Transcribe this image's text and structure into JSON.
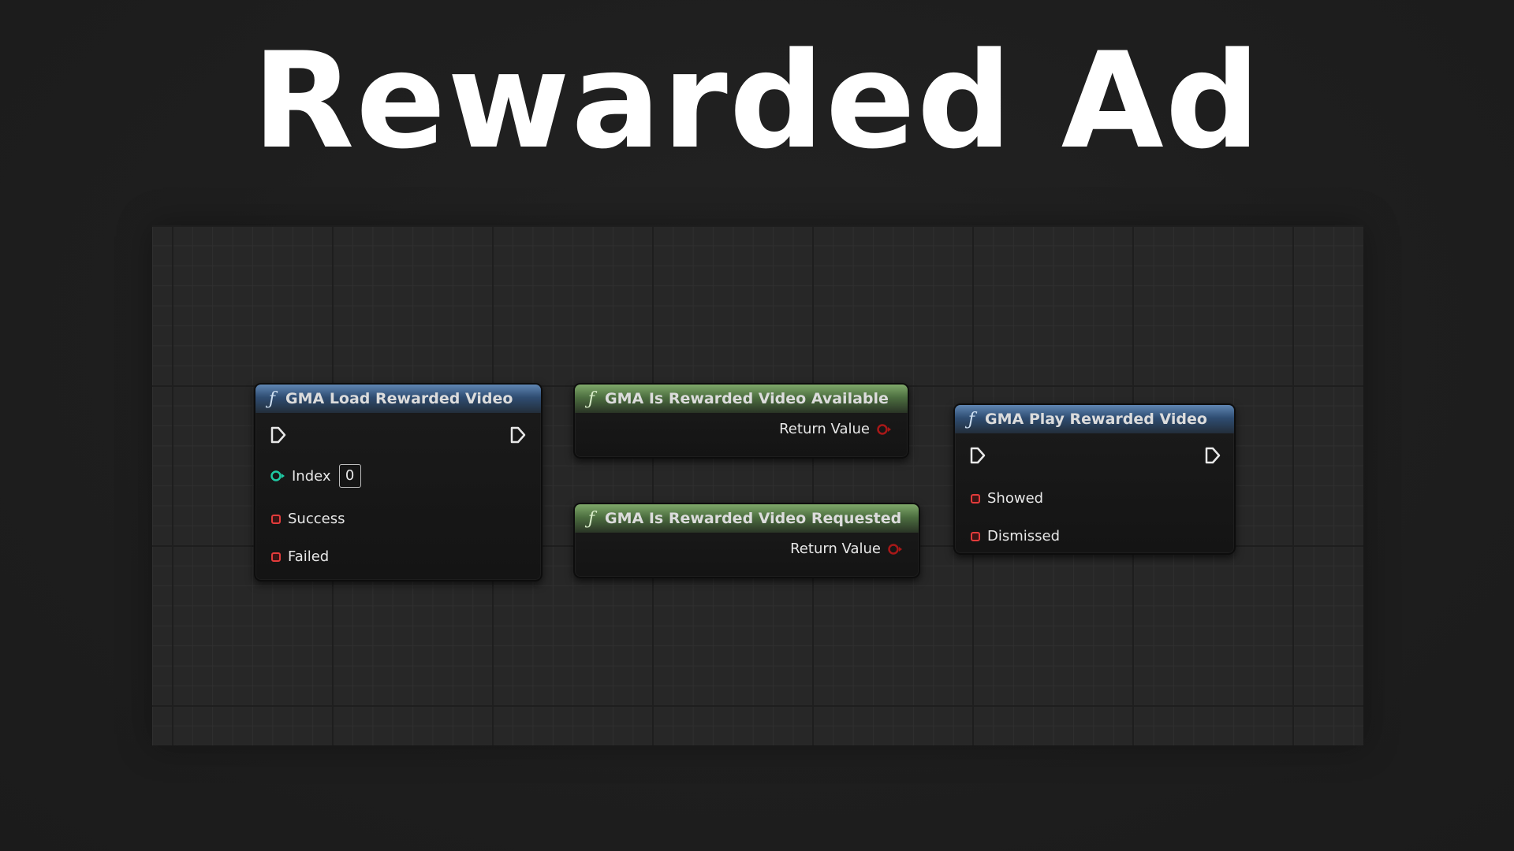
{
  "title": "Rewarded Ad",
  "nodes": {
    "load": {
      "title": "GMA Load Rewarded Video",
      "icon": "function-icon",
      "header_color": "#3f6a99",
      "index_label": "Index",
      "index_value": "0",
      "success_label": "Success",
      "failed_label": "Failed"
    },
    "available": {
      "title": "GMA Is Rewarded Video Available",
      "icon": "function-icon",
      "header_color": "#5b8a4c",
      "return_label": "Return Value"
    },
    "requested": {
      "title": "GMA Is Rewarded Video Requested",
      "icon": "function-icon",
      "header_color": "#5b8a4c",
      "return_label": "Return Value"
    },
    "play": {
      "title": "GMA Play Rewarded Video",
      "icon": "function-icon",
      "header_color": "#3f6a99",
      "showed_label": "Showed",
      "dismissed_label": "Dismissed"
    }
  },
  "colors": {
    "delegate_pin": "#e23b3b",
    "int_pin": "#1fc9a3",
    "bool_pin": "#a81818",
    "exec_pin": "#e8e8e8"
  }
}
